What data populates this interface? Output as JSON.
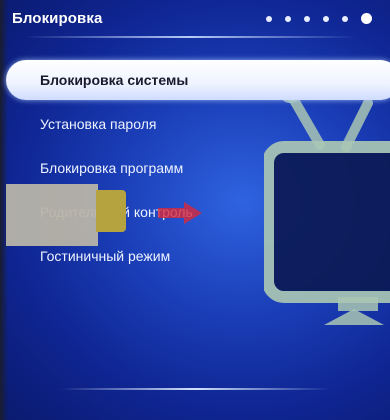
{
  "header": {
    "title": "Блокировка",
    "page_indicator": {
      "count": 6,
      "active_index": 5
    }
  },
  "menu": {
    "items": [
      {
        "label": "Блокировка системы",
        "selected": true
      },
      {
        "label": "Установка пароля",
        "selected": false
      },
      {
        "label": "Блокировка программ",
        "selected": false
      },
      {
        "label": "Родительский контроль",
        "selected": false
      },
      {
        "label": "Гостиничный режим",
        "selected": false
      }
    ]
  },
  "icons": {
    "tv": "tv-icon",
    "arrow": "arrow-right-icon"
  },
  "colors": {
    "background": "#1a3db6",
    "selected_item": "#ffffff",
    "tv_outline": "#a9c6b4",
    "arrow": "#d8283a"
  }
}
